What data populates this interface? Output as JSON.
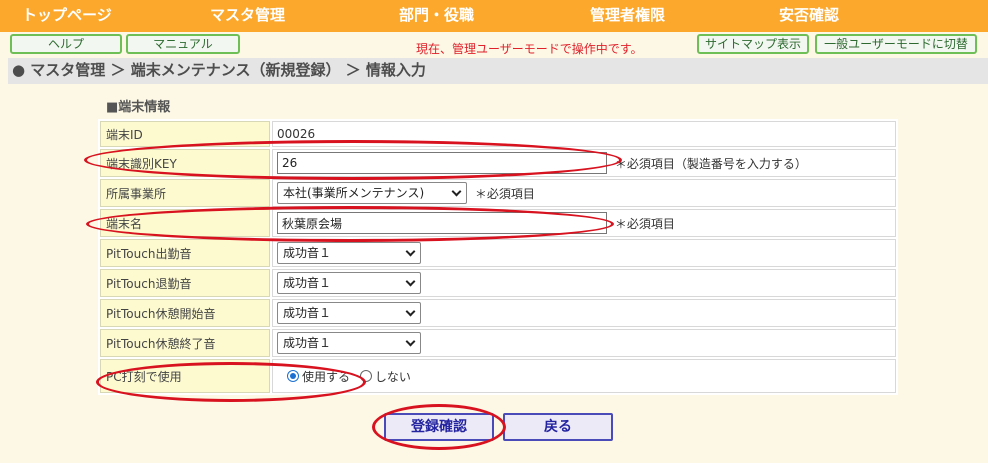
{
  "nav": [
    "トップページ",
    "マスタ管理",
    "部門・役職",
    "管理者権限",
    "安否確認"
  ],
  "toolbar": {
    "help": "ヘルプ",
    "manual": "マニュアル",
    "mode_message": "現在、管理ユーザーモードで操作中です。",
    "sitemap": "サイトマップ表示",
    "switch_user": "一般ユーザーモードに切替"
  },
  "breadcrumb": "● マスタ管理 ＞ 端末メンテナンス（新規登録） ＞ 情報入力",
  "section_title": "■端末情報",
  "fields": {
    "terminal_id": {
      "label": "端末ID",
      "value": "00026"
    },
    "terminal_key": {
      "label": "端末識別KEY",
      "value": "26",
      "note": "＊必須項目（製造番号を入力する）"
    },
    "office": {
      "label": "所属事業所",
      "value": "本社(事業所メンテナンス)",
      "note": "＊必須項目"
    },
    "terminal_name": {
      "label": "端末名",
      "value": "秋葉原会場",
      "note": "＊必須項目"
    },
    "sound_in": {
      "label": "PitTouch出勤音",
      "value": "成功音１"
    },
    "sound_out": {
      "label": "PitTouch退勤音",
      "value": "成功音１"
    },
    "sound_break_start": {
      "label": "PitTouch休憩開始音",
      "value": "成功音１"
    },
    "sound_break_end": {
      "label": "PitTouch休憩終了音",
      "value": "成功音１"
    },
    "pc_stamp": {
      "label": "PC打刻で使用",
      "option_use": "使用する",
      "option_nouse": "しない",
      "selected": "使用する"
    }
  },
  "actions": {
    "confirm": "登録確認",
    "back": "戻る"
  },
  "colors": {
    "nav_bg": "#fca82c",
    "annotation": "#d8121f",
    "label_bg": "#fdfad0"
  }
}
